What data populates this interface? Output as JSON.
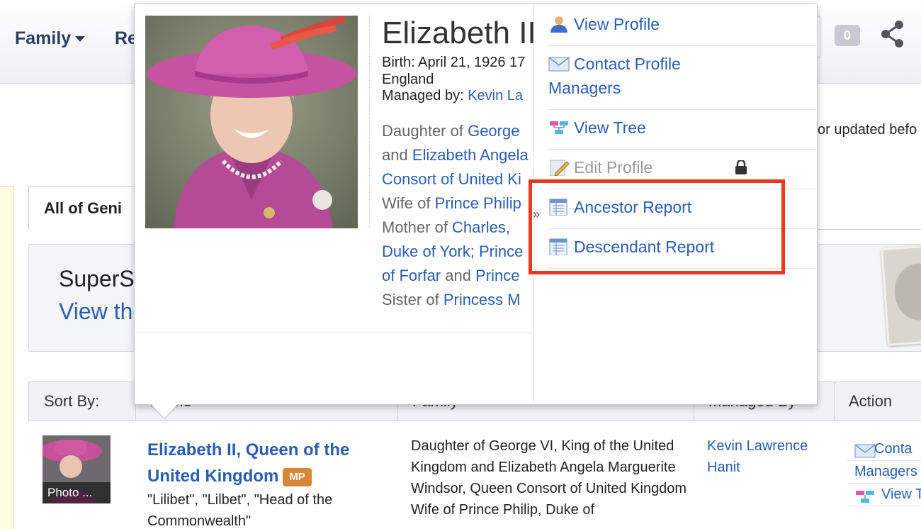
{
  "header": {
    "nav": [
      {
        "label": "Family"
      },
      {
        "label": "Re"
      }
    ],
    "notification_count": "0"
  },
  "notice_text": "or updated befo",
  "tabs": {
    "all_label": "All of Geni"
  },
  "supersearch": {
    "title": "SuperS",
    "link": "View the"
  },
  "table": {
    "headers": {
      "sort": "Sort By:",
      "name": "Name",
      "family": "Family",
      "managed": "Managed By",
      "action": "Action"
    },
    "row": {
      "thumb_label": "Photo ...",
      "name": "Elizabeth II, Queen of the United Kingdom",
      "badge": "MP",
      "nicknames": "\"Lilibet\", \"Lilbet\", \"Head of the Commonwealth\"",
      "family": "Daughter of George VI, King of the United Kingdom and Elizabeth Angela Marguerite Windsor, Queen Consort of United Kingdom Wife of Prince Philip, Duke of",
      "manager": "Kevin Lawrence Hanit",
      "actions": [
        "Conta",
        "Managers",
        "View T"
      ]
    }
  },
  "hovercard": {
    "name": "Elizabeth II",
    "birth_line1": "Birth: April 21, 1926 17",
    "birth_line2": "England",
    "managed_label": "Managed by: ",
    "managed_link": "Kevin La",
    "relations": [
      {
        "pre": "Daughter of ",
        "link": "George"
      },
      {
        "pre": "and ",
        "link": "Elizabeth Angela"
      },
      {
        "pre": "",
        "link": "Consort of United Ki"
      },
      {
        "pre": "Wife of ",
        "link": "Prince Philip"
      },
      {
        "pre": "Mother of ",
        "link": "Charles,"
      },
      {
        "pre": "",
        "link": "Duke of York; Prince"
      },
      {
        "pre": "",
        "link": "of Forfar",
        "post": " and ",
        "link2": "Prince"
      },
      {
        "pre": "Sister of ",
        "link": "Princess M"
      }
    ],
    "collapse_glyph": "»",
    "menu": {
      "view_profile": "View Profile",
      "contact_line1": "Contact Profile",
      "contact_line2": "Managers",
      "view_tree": "View Tree",
      "edit_profile": "Edit Profile",
      "ancestor_report": "Ancestor Report",
      "descendant_report": "Descendant Report"
    }
  },
  "colors": {
    "link": "#2a5db0",
    "highlight": "#e8381f",
    "badge": "#d6873a"
  }
}
